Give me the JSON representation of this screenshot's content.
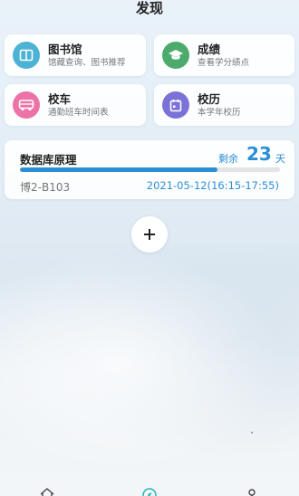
{
  "header": {
    "title": "发现"
  },
  "cards": [
    {
      "title": "图书馆",
      "subtitle": "馆藏查询、图书推荐",
      "icon": "book-icon",
      "color": "#4db3d4"
    },
    {
      "title": "成绩",
      "subtitle": "查看学分绩点",
      "icon": "graduation-cap-icon",
      "color": "#4cab6c"
    },
    {
      "title": "校车",
      "subtitle": "通勤班车时间表",
      "icon": "bus-icon",
      "color": "#ec72a8"
    },
    {
      "title": "校历",
      "subtitle": "本学年校历",
      "icon": "calendar-icon",
      "color": "#7b72d8"
    }
  ],
  "course": {
    "name": "数据库原理",
    "remain_label": "剩余",
    "remain_days": "23",
    "remain_unit": "天",
    "progress": 0.76,
    "room": "博2-B103",
    "time": "2021-05-12(16:15-17:55)",
    "accent": "#2b8fd6"
  },
  "add_button": {
    "icon": "plus-icon"
  },
  "tabbar": {
    "icons": [
      "home-icon",
      "compass-icon",
      "profile-icon"
    ],
    "active": "compass-icon",
    "active_color": "#23b8b0"
  }
}
